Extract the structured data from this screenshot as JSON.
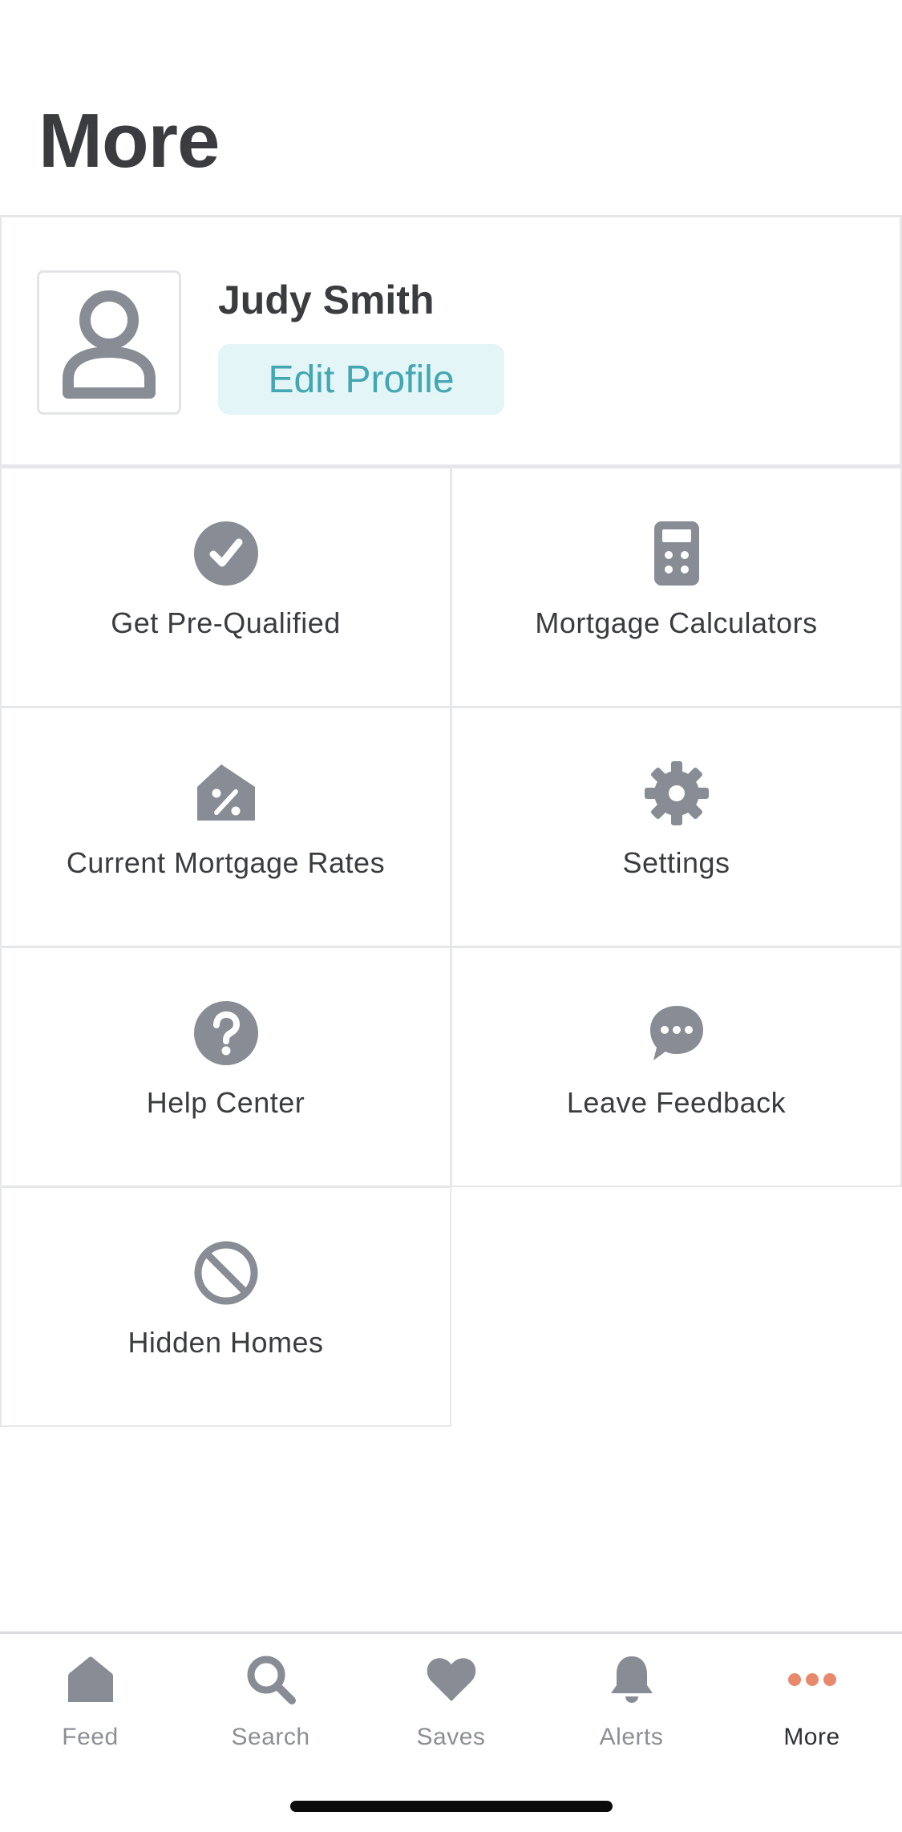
{
  "header": {
    "title": "More"
  },
  "profile": {
    "name": "Judy Smith",
    "edit_label": "Edit Profile"
  },
  "menu": [
    {
      "label": "Get Pre-Qualified",
      "icon": "check-circle-icon"
    },
    {
      "label": "Mortgage Calculators",
      "icon": "calculator-icon"
    },
    {
      "label": "Current Mortgage Rates",
      "icon": "percent-tag-icon"
    },
    {
      "label": "Settings",
      "icon": "gear-icon"
    },
    {
      "label": "Help Center",
      "icon": "question-circle-icon"
    },
    {
      "label": "Leave Feedback",
      "icon": "chat-bubble-icon"
    },
    {
      "label": "Hidden Homes",
      "icon": "prohibited-icon"
    }
  ],
  "tabs": [
    {
      "label": "Feed",
      "icon": "home-icon"
    },
    {
      "label": "Search",
      "icon": "search-icon"
    },
    {
      "label": "Saves",
      "icon": "heart-icon"
    },
    {
      "label": "Alerts",
      "icon": "bell-icon"
    },
    {
      "label": "More",
      "icon": "more-dots-icon",
      "active": true
    }
  ],
  "colors": {
    "icon_gray": "#888c94",
    "accent_teal": "#43a7b3",
    "accent_teal_bg": "#e3f5f6",
    "active_tab_dots": "#e8896c"
  }
}
